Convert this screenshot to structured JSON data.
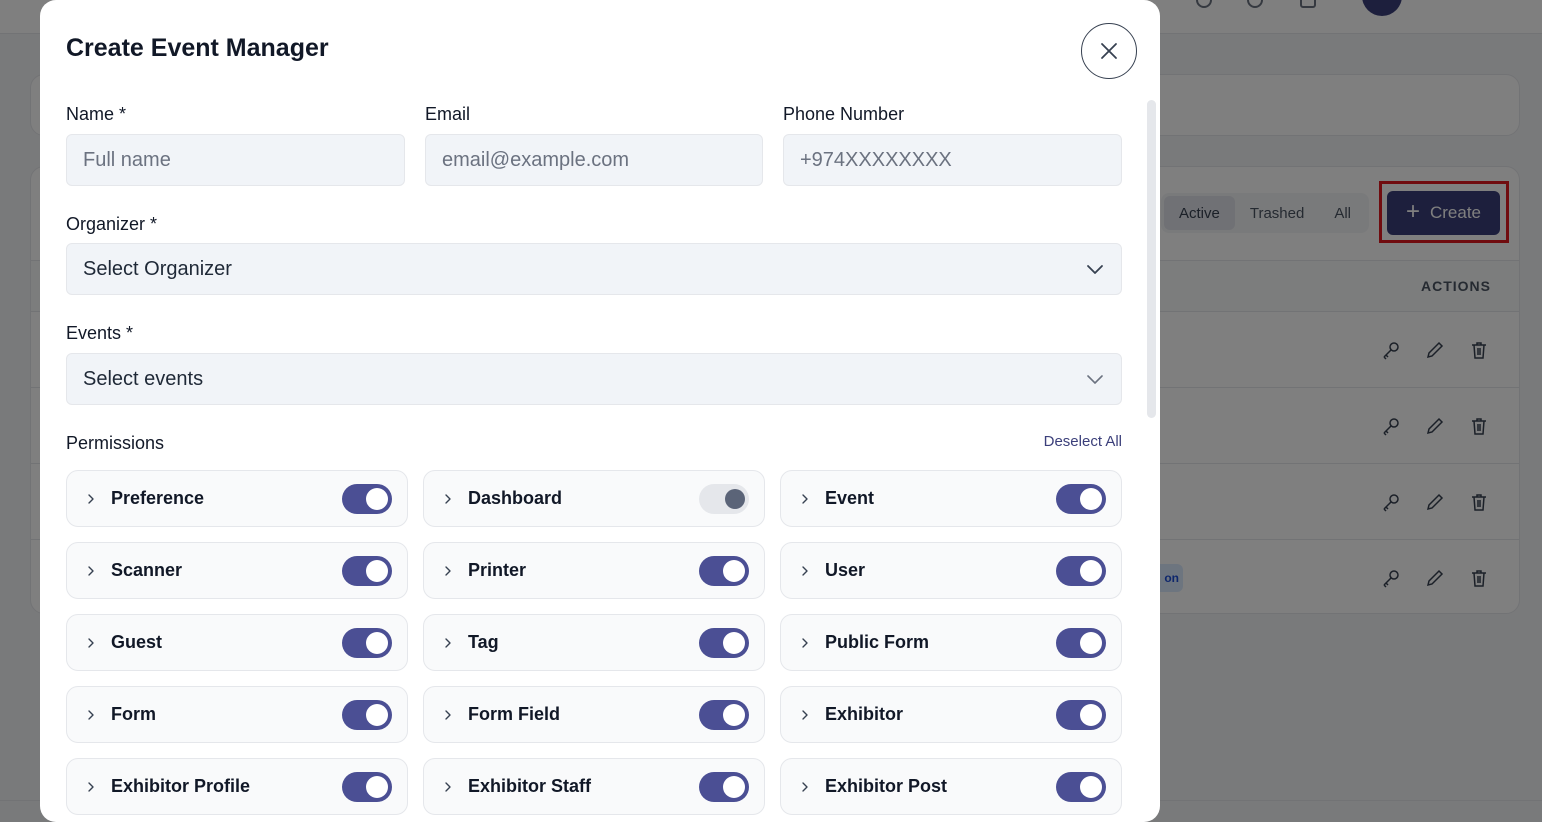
{
  "background": {
    "filters": [
      "Active",
      "Trashed",
      "All"
    ],
    "active_filter": "Active",
    "create_label": "Create",
    "actions_header": "ACTIONS",
    "badge_text": "on"
  },
  "modal": {
    "title": "Create Event Manager",
    "fields": {
      "name_label": "Name *",
      "name_placeholder": "Full name",
      "email_label": "Email",
      "email_placeholder": "email@example.com",
      "phone_label": "Phone Number",
      "phone_placeholder": "+974XXXXXXXX",
      "organizer_label": "Organizer *",
      "organizer_value": "Select Organizer",
      "events_label": "Events *",
      "events_value": "Select events"
    },
    "permissions_label": "Permissions",
    "deselect_all_label": "Deselect All",
    "permissions": [
      {
        "label": "Preference",
        "enabled": true
      },
      {
        "label": "Dashboard",
        "enabled": false
      },
      {
        "label": "Event",
        "enabled": true
      },
      {
        "label": "Scanner",
        "enabled": true
      },
      {
        "label": "Printer",
        "enabled": true
      },
      {
        "label": "User",
        "enabled": true
      },
      {
        "label": "Guest",
        "enabled": true
      },
      {
        "label": "Tag",
        "enabled": true
      },
      {
        "label": "Public Form",
        "enabled": true
      },
      {
        "label": "Form",
        "enabled": true
      },
      {
        "label": "Form Field",
        "enabled": true
      },
      {
        "label": "Exhibitor",
        "enabled": true
      },
      {
        "label": "Exhibitor Profile",
        "enabled": true
      },
      {
        "label": "Exhibitor Staff",
        "enabled": true
      },
      {
        "label": "Exhibitor Post",
        "enabled": true
      }
    ]
  },
  "colors": {
    "accent": "#3b3f7a",
    "toggle_on": "#4b4f94",
    "highlight": "#e0191f"
  }
}
